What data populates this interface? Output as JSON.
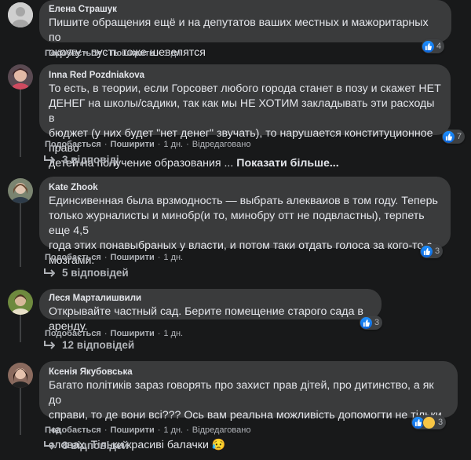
{
  "actions": {
    "like": "Подобається",
    "reply": "Поширити",
    "edited": "Відредаговано"
  },
  "comments": [
    {
      "author": "Елена Страшук",
      "text": "Пишите обращения ещё и на депутатов ваших местных и мажоритарных по\nокругу - пусть тоже шевелятся",
      "time": "1 дн.",
      "reactions": "4"
    },
    {
      "author": "Inna Red Pozdniakova",
      "text": "То есть, в теории, если Горсовет любого города станет в позу и скажет НЕТ\nДЕНЕГ на школы/садики, так как мы НЕ ХОТИМ закладывать эти расходы в\nбюджет (у них будет \"нет денег\" звучать), то нарушается конституционное право\nдетей на получение образования ...",
      "more": "Показати більше...",
      "time": "1 дн.",
      "reactions": "7",
      "replies": "3 відповіді"
    },
    {
      "author": "Kate Zhook",
      "text": "Единсивенная была врзмодность — выбрать алекваиов в том году. Теперь\nтолько журналисты и минобр(и то, минобру отт не подвластны), терпеть еще 4,5\nгода этих понавыбраных у власти, и потом таки отдать голоса за кого-то с\nмозгами.",
      "time": "1 дн.",
      "reactions": "3",
      "replies": "5 відповідей"
    },
    {
      "author": "Леся Марталишвили",
      "text": "Открывайте частный сад. Берите помещение старого сада в аренду.",
      "time": "1 дн.",
      "reactions": "3",
      "replies": "12 відповідей"
    },
    {
      "author": "Ксенія Якубовська",
      "text": "Багато політиків зараз говорять про захист прав дітей, про дитинство, а як до\nсправи, то де вони всі??? Ось вам реальна можливість допомогти не тільки на\nсловах. Тільки красиві балачки 😥",
      "time": "1 дн.",
      "reactions": "3",
      "replies": "8 відповідей"
    }
  ],
  "colors": {
    "background": "#18191a",
    "bubble": "#3a3b3c",
    "text": "#e4e6eb",
    "muted": "#b0b3b8",
    "like": "#1877f2"
  }
}
